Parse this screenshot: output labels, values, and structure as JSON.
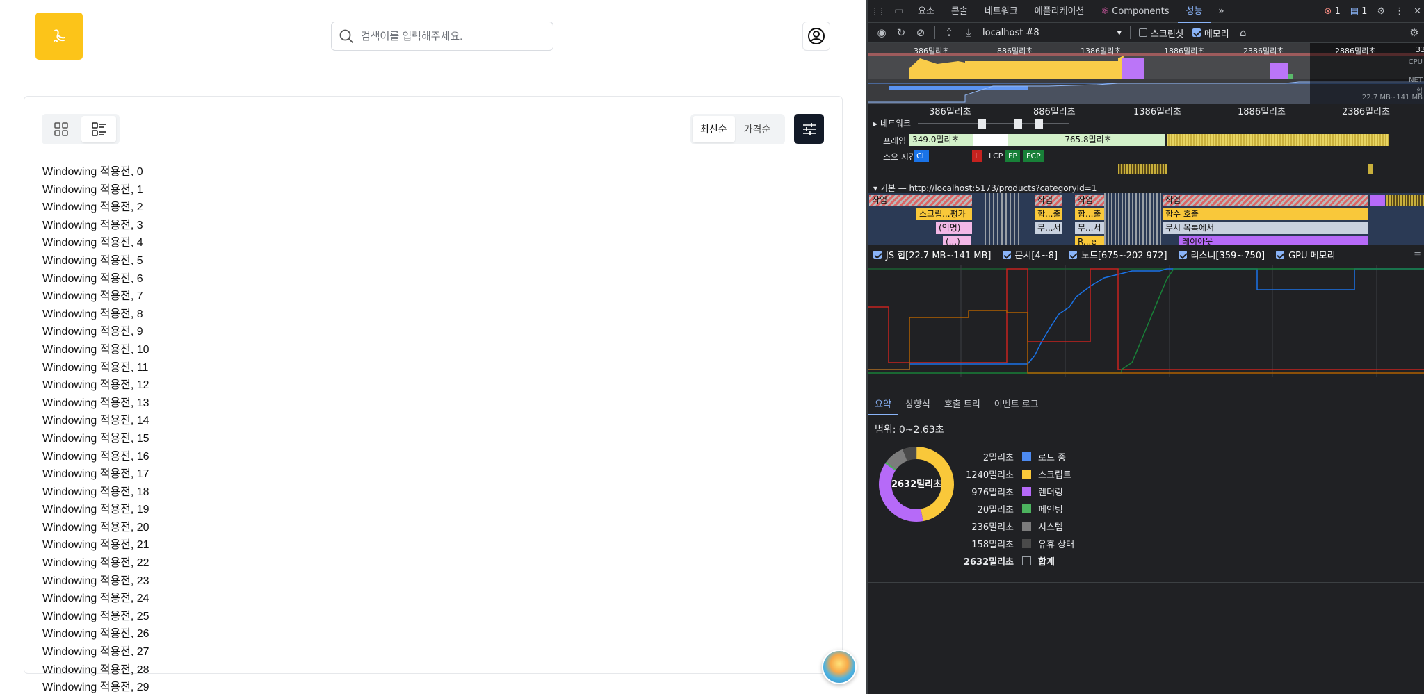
{
  "app": {
    "search_placeholder": "검색어를 입력해주세요.",
    "sort": {
      "latest": "최신순",
      "price": "가격순"
    },
    "items": [
      "Windowing 적용전, 0",
      "Windowing 적용전, 1",
      "Windowing 적용전, 2",
      "Windowing 적용전, 3",
      "Windowing 적용전, 4",
      "Windowing 적용전, 5",
      "Windowing 적용전, 6",
      "Windowing 적용전, 7",
      "Windowing 적용전, 8",
      "Windowing 적용전, 9",
      "Windowing 적용전, 10",
      "Windowing 적용전, 11",
      "Windowing 적용전, 12",
      "Windowing 적용전, 13",
      "Windowing 적용전, 14",
      "Windowing 적용전, 15",
      "Windowing 적용전, 16",
      "Windowing 적용전, 17",
      "Windowing 적용전, 18",
      "Windowing 적용전, 19",
      "Windowing 적용전, 20",
      "Windowing 적용전, 21",
      "Windowing 적용전, 22",
      "Windowing 적용전, 23",
      "Windowing 적용전, 24",
      "Windowing 적용전, 25",
      "Windowing 적용전, 26",
      "Windowing 적용전, 27",
      "Windowing 적용전, 28",
      "Windowing 적용전, 29"
    ],
    "colors": {
      "logo": "#fcc419",
      "filter_button": "#131a28"
    }
  },
  "devtools": {
    "tabs": [
      "요소",
      "콘솔",
      "네트워크",
      "애플리케이션",
      "Components",
      "성능"
    ],
    "active_tab": "성능",
    "error_count": "1",
    "message_count": "1",
    "recording": "localhost #8",
    "screenshot_label": "스크린샷",
    "memory_label": "메모리",
    "overview_ticks": [
      "386밀리초",
      "886밀리초",
      "1386밀리초",
      "1886밀리초",
      "2386밀리초",
      "2886밀리초",
      "33"
    ],
    "overview_labels": {
      "cpu": "CPU",
      "net": "NET",
      "heap": "힙",
      "heap_range": "22.7 MB~141 MB"
    },
    "flame_ticks": [
      "386밀리초",
      "886밀리초",
      "1386밀리초",
      "1886밀리초",
      "2386밀리초"
    ],
    "tracks": {
      "network": "네트워크",
      "frames": "프레임",
      "timings": "소요 시간",
      "main": "기본 — http://localhost:5173/products?categoryId=1"
    },
    "frame_values": [
      "349.0밀리초",
      "765.8밀리초"
    ],
    "timing_markers": [
      "CL",
      "L",
      "LCP",
      "FP",
      "FCP"
    ],
    "flame_labels": [
      "작업",
      "작업",
      "작업",
      "작업",
      "스크립...평가",
      "함...출",
      "함...출",
      "함수 호출",
      "(익명)",
      "무...서",
      "무...서",
      "무시 목록에서",
      "(...)",
      "R...e",
      "레이아웃"
    ],
    "counters": [
      {
        "label": "JS 힙[22.7 MB~141 MB]",
        "color": "#1a73e8"
      },
      {
        "label": "문서[4~8]",
        "color": "#c5221f"
      },
      {
        "label": "노드[675~202 972]",
        "color": "#188038"
      },
      {
        "label": "리스너[359~750]",
        "color": "#b06000"
      },
      {
        "label": "GPU 메모리",
        "color": "#9334e6"
      }
    ],
    "bottom_tabs": [
      "요약",
      "상향식",
      "호출 트리",
      "이벤트 로그"
    ],
    "range": "범위: 0~2.63초",
    "donut_center": "2632밀리초",
    "summary": [
      {
        "value": "2밀리초",
        "label": "로드 중",
        "color": "#4d8af0"
      },
      {
        "value": "1240밀리초",
        "label": "스크립트",
        "color": "#f9c83a"
      },
      {
        "value": "976밀리초",
        "label": "렌더링",
        "color": "#b66af8"
      },
      {
        "value": "20밀리초",
        "label": "페인팅",
        "color": "#4cb35e"
      },
      {
        "value": "236밀리초",
        "label": "시스템",
        "color": "#7c7c7c"
      },
      {
        "value": "158밀리초",
        "label": "유휴 상태",
        "color": "#4a4a4a"
      },
      {
        "value": "2632밀리초",
        "label": "합계",
        "color": ""
      }
    ]
  }
}
